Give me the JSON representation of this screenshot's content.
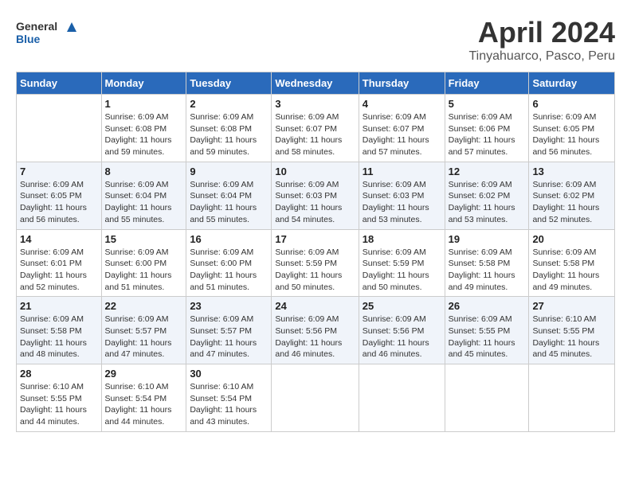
{
  "header": {
    "logo_line1": "General",
    "logo_line2": "Blue",
    "month_title": "April 2024",
    "subtitle": "Tinyahuarco, Pasco, Peru"
  },
  "weekdays": [
    "Sunday",
    "Monday",
    "Tuesday",
    "Wednesday",
    "Thursday",
    "Friday",
    "Saturday"
  ],
  "weeks": [
    [
      {
        "day": "",
        "info": ""
      },
      {
        "day": "1",
        "info": "Sunrise: 6:09 AM\nSunset: 6:08 PM\nDaylight: 11 hours\nand 59 minutes."
      },
      {
        "day": "2",
        "info": "Sunrise: 6:09 AM\nSunset: 6:08 PM\nDaylight: 11 hours\nand 59 minutes."
      },
      {
        "day": "3",
        "info": "Sunrise: 6:09 AM\nSunset: 6:07 PM\nDaylight: 11 hours\nand 58 minutes."
      },
      {
        "day": "4",
        "info": "Sunrise: 6:09 AM\nSunset: 6:07 PM\nDaylight: 11 hours\nand 57 minutes."
      },
      {
        "day": "5",
        "info": "Sunrise: 6:09 AM\nSunset: 6:06 PM\nDaylight: 11 hours\nand 57 minutes."
      },
      {
        "day": "6",
        "info": "Sunrise: 6:09 AM\nSunset: 6:05 PM\nDaylight: 11 hours\nand 56 minutes."
      }
    ],
    [
      {
        "day": "7",
        "info": "Sunrise: 6:09 AM\nSunset: 6:05 PM\nDaylight: 11 hours\nand 56 minutes."
      },
      {
        "day": "8",
        "info": "Sunrise: 6:09 AM\nSunset: 6:04 PM\nDaylight: 11 hours\nand 55 minutes."
      },
      {
        "day": "9",
        "info": "Sunrise: 6:09 AM\nSunset: 6:04 PM\nDaylight: 11 hours\nand 55 minutes."
      },
      {
        "day": "10",
        "info": "Sunrise: 6:09 AM\nSunset: 6:03 PM\nDaylight: 11 hours\nand 54 minutes."
      },
      {
        "day": "11",
        "info": "Sunrise: 6:09 AM\nSunset: 6:03 PM\nDaylight: 11 hours\nand 53 minutes."
      },
      {
        "day": "12",
        "info": "Sunrise: 6:09 AM\nSunset: 6:02 PM\nDaylight: 11 hours\nand 53 minutes."
      },
      {
        "day": "13",
        "info": "Sunrise: 6:09 AM\nSunset: 6:02 PM\nDaylight: 11 hours\nand 52 minutes."
      }
    ],
    [
      {
        "day": "14",
        "info": "Sunrise: 6:09 AM\nSunset: 6:01 PM\nDaylight: 11 hours\nand 52 minutes."
      },
      {
        "day": "15",
        "info": "Sunrise: 6:09 AM\nSunset: 6:00 PM\nDaylight: 11 hours\nand 51 minutes."
      },
      {
        "day": "16",
        "info": "Sunrise: 6:09 AM\nSunset: 6:00 PM\nDaylight: 11 hours\nand 51 minutes."
      },
      {
        "day": "17",
        "info": "Sunrise: 6:09 AM\nSunset: 5:59 PM\nDaylight: 11 hours\nand 50 minutes."
      },
      {
        "day": "18",
        "info": "Sunrise: 6:09 AM\nSunset: 5:59 PM\nDaylight: 11 hours\nand 50 minutes."
      },
      {
        "day": "19",
        "info": "Sunrise: 6:09 AM\nSunset: 5:58 PM\nDaylight: 11 hours\nand 49 minutes."
      },
      {
        "day": "20",
        "info": "Sunrise: 6:09 AM\nSunset: 5:58 PM\nDaylight: 11 hours\nand 49 minutes."
      }
    ],
    [
      {
        "day": "21",
        "info": "Sunrise: 6:09 AM\nSunset: 5:58 PM\nDaylight: 11 hours\nand 48 minutes."
      },
      {
        "day": "22",
        "info": "Sunrise: 6:09 AM\nSunset: 5:57 PM\nDaylight: 11 hours\nand 47 minutes."
      },
      {
        "day": "23",
        "info": "Sunrise: 6:09 AM\nSunset: 5:57 PM\nDaylight: 11 hours\nand 47 minutes."
      },
      {
        "day": "24",
        "info": "Sunrise: 6:09 AM\nSunset: 5:56 PM\nDaylight: 11 hours\nand 46 minutes."
      },
      {
        "day": "25",
        "info": "Sunrise: 6:09 AM\nSunset: 5:56 PM\nDaylight: 11 hours\nand 46 minutes."
      },
      {
        "day": "26",
        "info": "Sunrise: 6:09 AM\nSunset: 5:55 PM\nDaylight: 11 hours\nand 45 minutes."
      },
      {
        "day": "27",
        "info": "Sunrise: 6:10 AM\nSunset: 5:55 PM\nDaylight: 11 hours\nand 45 minutes."
      }
    ],
    [
      {
        "day": "28",
        "info": "Sunrise: 6:10 AM\nSunset: 5:55 PM\nDaylight: 11 hours\nand 44 minutes."
      },
      {
        "day": "29",
        "info": "Sunrise: 6:10 AM\nSunset: 5:54 PM\nDaylight: 11 hours\nand 44 minutes."
      },
      {
        "day": "30",
        "info": "Sunrise: 6:10 AM\nSunset: 5:54 PM\nDaylight: 11 hours\nand 43 minutes."
      },
      {
        "day": "",
        "info": ""
      },
      {
        "day": "",
        "info": ""
      },
      {
        "day": "",
        "info": ""
      },
      {
        "day": "",
        "info": ""
      }
    ]
  ]
}
